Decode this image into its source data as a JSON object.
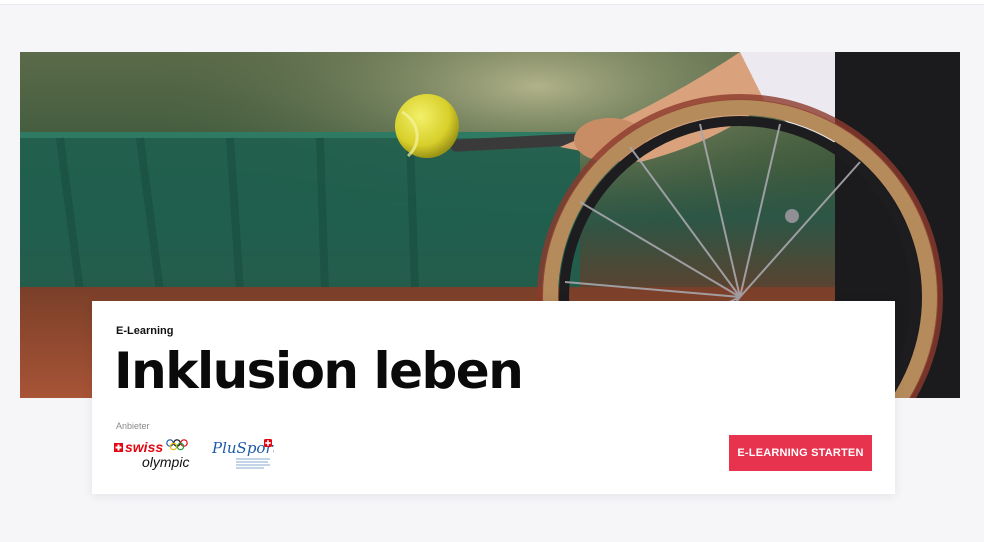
{
  "hero": {
    "image_icon": "wheelchair-tennis-photo"
  },
  "card": {
    "eyebrow": "E-Learning",
    "title": "Inklusion leben",
    "provider_label": "Anbieter",
    "providers": [
      {
        "name": "swiss olympic",
        "icon": "swiss-olympic-logo",
        "text_top": "swiss",
        "text_bottom": "olympic"
      },
      {
        "name": "PluSport",
        "icon": "plusport-logo",
        "text": "PluSport"
      }
    ],
    "cta_label": "E-LEARNING STARTEN"
  },
  "colors": {
    "accent": "#e8334f",
    "background": "#f6f6f9",
    "card": "#ffffff",
    "swiss_red": "#e30613",
    "plusport_blue": "#1d5aa8"
  }
}
